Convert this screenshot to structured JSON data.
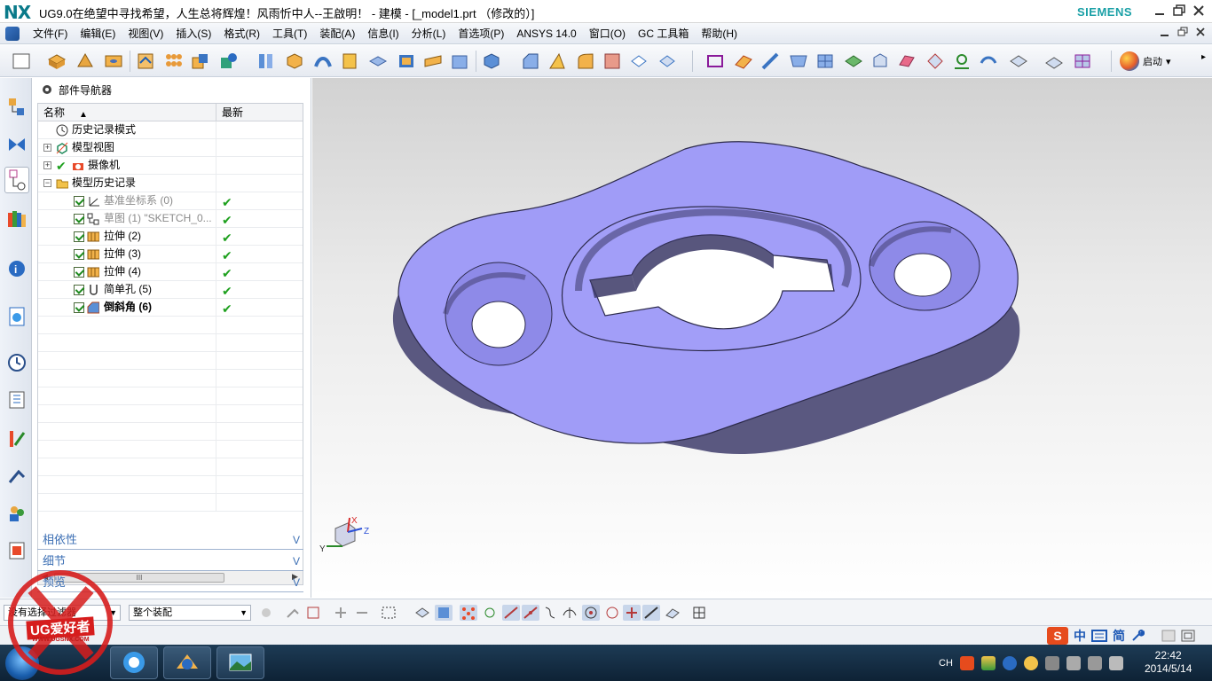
{
  "titlebar": {
    "logo": "NX",
    "title": "UG9.0在绝望中寻找希望，人生总将辉煌！风雨忻中人--王啟明！ - 建模 - [_model1.prt （修改的）]",
    "brand": "SIEMENS",
    "buttons": [
      "minimize",
      "restore",
      "close"
    ]
  },
  "menu": {
    "items": [
      "文件(F)",
      "编辑(E)",
      "视图(V)",
      "插入(S)",
      "格式(R)",
      "工具(T)",
      "装配(A)",
      "信息(I)",
      "分析(L)",
      "首选项(P)",
      "ANSYS 14.0",
      "窗口(O)",
      "GC 工具箱",
      "帮助(H)"
    ]
  },
  "toolbar": {
    "start_label": "启动",
    "start_arrow": "▾",
    "more_arrow": "▸"
  },
  "navigator": {
    "title": "部件导航器",
    "col_name": "名称",
    "col_latest": "最新",
    "sort_glyph": "▲",
    "rows": [
      {
        "label": "历史记录模式",
        "style": "normal",
        "checked": false,
        "latest": false,
        "exp": ""
      },
      {
        "label": "模型视图",
        "style": "normal",
        "checked": false,
        "latest": false,
        "exp": "+"
      },
      {
        "label": "摄像机",
        "style": "normal",
        "checked": false,
        "latest": false,
        "exp": "+"
      },
      {
        "label": "模型历史记录",
        "style": "normal",
        "checked": false,
        "latest": false,
        "exp": "−"
      },
      {
        "label": "基准坐标系 (0)",
        "style": "dim",
        "checked": true,
        "latest": true,
        "exp": ""
      },
      {
        "label": "草图 (1) \"SKETCH_0...",
        "style": "dim",
        "checked": true,
        "latest": true,
        "exp": ""
      },
      {
        "label": "拉伸 (2)",
        "style": "normal",
        "checked": true,
        "latest": true,
        "exp": ""
      },
      {
        "label": "拉伸 (3)",
        "style": "normal",
        "checked": true,
        "latest": true,
        "exp": ""
      },
      {
        "label": "拉伸 (4)",
        "style": "normal",
        "checked": true,
        "latest": true,
        "exp": ""
      },
      {
        "label": "简单孔 (5)",
        "style": "normal",
        "checked": true,
        "latest": true,
        "exp": ""
      },
      {
        "label": "倒斜角 (6)",
        "style": "bold",
        "checked": true,
        "latest": true,
        "exp": ""
      }
    ],
    "tick_glyph": "✔",
    "scroll_thumb_label": "III",
    "scroll_left": "◀",
    "scroll_right": "▶",
    "panels": [
      "相依性",
      "细节",
      "预览"
    ],
    "panel_chevron": "V"
  },
  "viewport": {
    "model_color": "#a09cf7",
    "model_side_color": "#5a5880",
    "triad_x": "X",
    "triad_y": "Y",
    "triad_z": "Z"
  },
  "selection_bar": {
    "filter_value": "没有选择过滤器",
    "scope_value": "整个装配",
    "dropdown_arrow": "▼"
  },
  "statusbar": {
    "ime_zh": "中",
    "ime_mode": "简",
    "ime_logo": "S"
  },
  "taskbar": {
    "lang": "CH",
    "time": "22:42",
    "date": "2014/5/14"
  },
  "watermark": {
    "brand": "UG爱好者",
    "url": "WWW.UGSNX.COM"
  }
}
